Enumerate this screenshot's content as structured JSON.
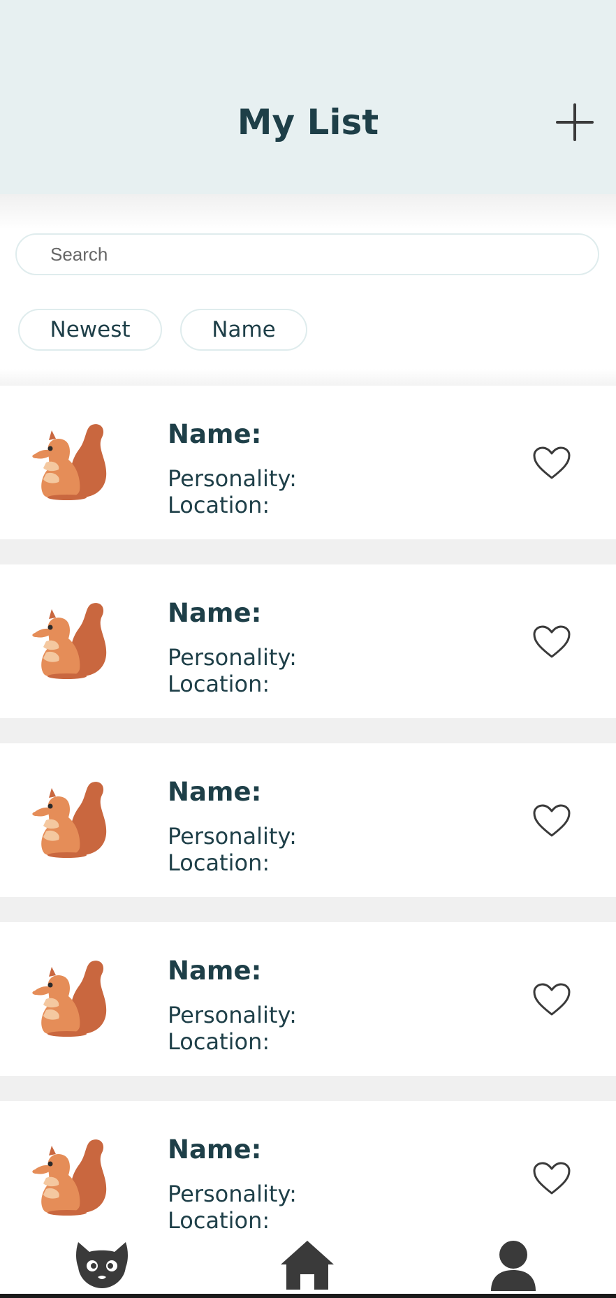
{
  "header": {
    "title": "My List",
    "add_icon": "plus-icon",
    "background": "#e7f0f1"
  },
  "search": {
    "placeholder": "Search",
    "value": ""
  },
  "sort": {
    "newest_label": "Newest",
    "name_label": "Name"
  },
  "cards": [
    {
      "name_label": "Name:",
      "personality_label": "Personality:",
      "location_label": "Location:",
      "image": "squirrel-image",
      "favorite_icon": "heart-outline-icon"
    },
    {
      "name_label": "Name:",
      "personality_label": "Personality:",
      "location_label": "Location:",
      "image": "squirrel-image",
      "favorite_icon": "heart-outline-icon"
    },
    {
      "name_label": "Name:",
      "personality_label": "Personality:",
      "location_label": "Location:",
      "image": "squirrel-image",
      "favorite_icon": "heart-outline-icon"
    },
    {
      "name_label": "Name:",
      "personality_label": "Personality:",
      "location_label": "Location:",
      "image": "squirrel-image",
      "favorite_icon": "heart-outline-icon"
    },
    {
      "name_label": "Name:",
      "personality_label": "Personality:",
      "location_label": "Location:",
      "image": "squirrel-image",
      "favorite_icon": "heart-outline-icon"
    }
  ],
  "nav": {
    "items": [
      "fox-icon",
      "home-icon",
      "profile-icon"
    ]
  },
  "colors": {
    "text": "#1e3f48",
    "squirrel_body": "#e58d58",
    "squirrel_tail": "#c9673f",
    "icon_dark": "#3a3a3a"
  }
}
